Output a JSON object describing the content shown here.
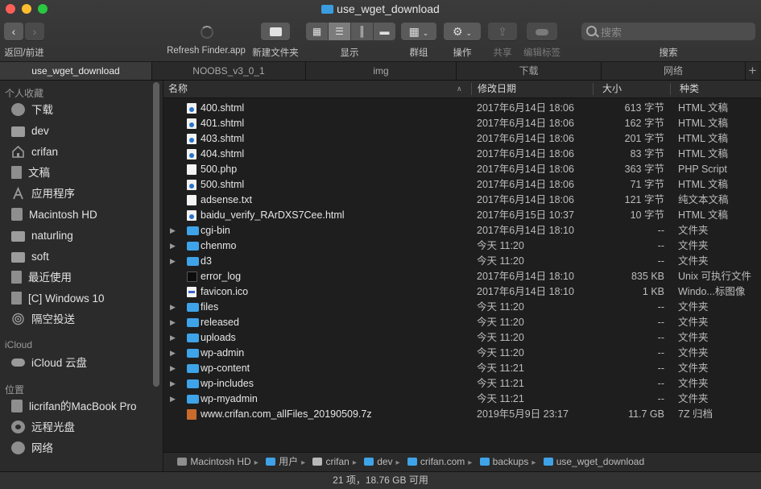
{
  "window": {
    "title": "use_wget_download"
  },
  "toolbar": {
    "back_forward_label": "返回/前进",
    "refresh_label": "Refresh Finder.app",
    "new_folder_label": "新建文件夹",
    "view_label": "显示",
    "group_label": "群组",
    "action_label": "操作",
    "share_label": "共享",
    "tags_label": "编辑标签",
    "search_label": "搜索",
    "search_placeholder": "搜索"
  },
  "tabs": [
    {
      "label": "use_wget_download",
      "active": true
    },
    {
      "label": "NOOBS_v3_0_1",
      "active": false
    },
    {
      "label": "img",
      "active": false
    },
    {
      "label": "下载",
      "active": false
    },
    {
      "label": "网络",
      "active": false
    }
  ],
  "sidebar": {
    "favorites_title": "个人收藏",
    "favorites": [
      {
        "label": "下载",
        "icon": "download-icon"
      },
      {
        "label": "dev",
        "icon": "folder-icon"
      },
      {
        "label": "crifan",
        "icon": "home-icon"
      },
      {
        "label": "文稿",
        "icon": "document-icon"
      },
      {
        "label": "应用程序",
        "icon": "applications-icon"
      },
      {
        "label": "Macintosh HD",
        "icon": "disk-icon"
      },
      {
        "label": "naturling",
        "icon": "folder-icon"
      },
      {
        "label": "soft",
        "icon": "folder-icon"
      },
      {
        "label": "最近使用",
        "icon": "recents-icon"
      },
      {
        "label": "[C] Windows 10",
        "icon": "document-icon"
      },
      {
        "label": "隔空投送",
        "icon": "airdrop-icon"
      }
    ],
    "icloud_title": "iCloud",
    "icloud": [
      {
        "label": "iCloud 云盘",
        "icon": "cloud-icon"
      }
    ],
    "locations_title": "位置",
    "locations": [
      {
        "label": "licrifan的MacBook Pro",
        "icon": "laptop-icon"
      },
      {
        "label": "远程光盘",
        "icon": "optical-disc-icon"
      },
      {
        "label": "网络",
        "icon": "network-icon"
      }
    ]
  },
  "columns": {
    "name": "名称",
    "date": "修改日期",
    "size": "大小",
    "kind": "种类"
  },
  "files": [
    {
      "name": "400.shtml",
      "date": "2017年6月14日 18:06",
      "size": "613 字节",
      "kind": "HTML 文稿",
      "type": "file",
      "folder": false
    },
    {
      "name": "401.shtml",
      "date": "2017年6月14日 18:06",
      "size": "162 字节",
      "kind": "HTML 文稿",
      "type": "file",
      "folder": false
    },
    {
      "name": "403.shtml",
      "date": "2017年6月14日 18:06",
      "size": "201 字节",
      "kind": "HTML 文稿",
      "type": "file",
      "folder": false
    },
    {
      "name": "404.shtml",
      "date": "2017年6月14日 18:06",
      "size": "83 字节",
      "kind": "HTML 文稿",
      "type": "file",
      "folder": false
    },
    {
      "name": "500.php",
      "date": "2017年6月14日 18:06",
      "size": "363 字节",
      "kind": "PHP Script",
      "type": "php",
      "folder": false
    },
    {
      "name": "500.shtml",
      "date": "2017年6月14日 18:06",
      "size": "71 字节",
      "kind": "HTML 文稿",
      "type": "file",
      "folder": false
    },
    {
      "name": "adsense.txt",
      "date": "2017年6月14日 18:06",
      "size": "121 字节",
      "kind": "纯文本文稿",
      "type": "text",
      "folder": false
    },
    {
      "name": "baidu_verify_RArDXS7Cee.html",
      "date": "2017年6月15日 10:37",
      "size": "10 字节",
      "kind": "HTML 文稿",
      "type": "file",
      "folder": false
    },
    {
      "name": "cgi-bin",
      "date": "2017年6月14日 18:10",
      "size": "--",
      "kind": "文件夹",
      "type": "folder",
      "folder": true
    },
    {
      "name": "chenmo",
      "date": "今天 11:20",
      "size": "--",
      "kind": "文件夹",
      "type": "folder",
      "folder": true
    },
    {
      "name": "d3",
      "date": "今天 11:20",
      "size": "--",
      "kind": "文件夹",
      "type": "folder",
      "folder": true
    },
    {
      "name": "error_log",
      "date": "2017年6月14日 18:10",
      "size": "835 KB",
      "kind": "Unix 可执行文件",
      "type": "exec",
      "folder": false
    },
    {
      "name": "favicon.ico",
      "date": "2017年6月14日 18:10",
      "size": "1 KB",
      "kind": "Windo...标图像",
      "type": "ico",
      "folder": false
    },
    {
      "name": "files",
      "date": "今天 11:20",
      "size": "--",
      "kind": "文件夹",
      "type": "folder",
      "folder": true
    },
    {
      "name": "released",
      "date": "今天 11:20",
      "size": "--",
      "kind": "文件夹",
      "type": "folder",
      "folder": true
    },
    {
      "name": "uploads",
      "date": "今天 11:20",
      "size": "--",
      "kind": "文件夹",
      "type": "folder",
      "folder": true
    },
    {
      "name": "wp-admin",
      "date": "今天 11:20",
      "size": "--",
      "kind": "文件夹",
      "type": "folder",
      "folder": true
    },
    {
      "name": "wp-content",
      "date": "今天 11:21",
      "size": "--",
      "kind": "文件夹",
      "type": "folder",
      "folder": true
    },
    {
      "name": "wp-includes",
      "date": "今天 11:21",
      "size": "--",
      "kind": "文件夹",
      "type": "folder",
      "folder": true
    },
    {
      "name": "wp-myadmin",
      "date": "今天 11:21",
      "size": "--",
      "kind": "文件夹",
      "type": "folder",
      "folder": true
    },
    {
      "name": "www.crifan.com_allFiles_20190509.7z",
      "date": "2019年5月9日 23:17",
      "size": "11.7 GB",
      "kind": "7Z 归档",
      "type": "archive",
      "folder": false
    }
  ],
  "path": [
    {
      "label": "Macintosh HD",
      "icon": "disk-icon"
    },
    {
      "label": "用户",
      "icon": "folder-icon"
    },
    {
      "label": "crifan",
      "icon": "home-icon"
    },
    {
      "label": "dev",
      "icon": "folder-icon"
    },
    {
      "label": "crifan.com",
      "icon": "folder-icon"
    },
    {
      "label": "backups",
      "icon": "folder-icon"
    },
    {
      "label": "use_wget_download",
      "icon": "folder-icon"
    }
  ],
  "status": "21 项，18.76 GB 可用",
  "colors": {
    "folder_blue": "#3ea3e8",
    "background": "#1e1e1e",
    "sidebar": "#2b2b2b"
  }
}
